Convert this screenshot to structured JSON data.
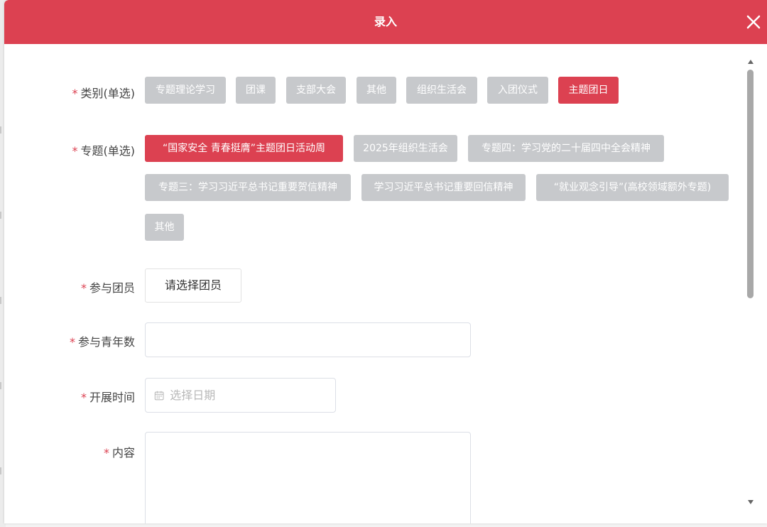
{
  "modal": {
    "title": "录入"
  },
  "form": {
    "category": {
      "label": "类别(单选)",
      "options": [
        "专题理论学习",
        "团课",
        "支部大会",
        "其他",
        "组织生活会",
        "入团仪式",
        "主题团日"
      ],
      "selected": "主题团日"
    },
    "topic": {
      "label": "专题(单选)",
      "options": [
        "“国家安全 青春挺膺”主题团日活动周",
        "2025年组织生活会",
        "专题四：学习党的二十届四中全会精神",
        "专题三：学习习近平总书记重要贺信精神",
        "学习习近平总书记重要回信精神",
        "“就业观念引导”(高校领域额外专题)",
        "其他"
      ],
      "selected": "“国家安全 青春挺膺”主题团日活动周"
    },
    "members": {
      "label": "参与团员",
      "button_label": "请选择团员"
    },
    "youth_count": {
      "label": "参与青年数",
      "value": ""
    },
    "date": {
      "label": "开展时间",
      "placeholder": "选择日期"
    },
    "content": {
      "label": "内容",
      "value": ""
    },
    "required_mark": "*"
  },
  "colors": {
    "brand": "#dc4151",
    "tag_inactive": "#c7c9cc"
  },
  "icons": {
    "close": "close-icon",
    "calendar": "calendar-icon"
  }
}
